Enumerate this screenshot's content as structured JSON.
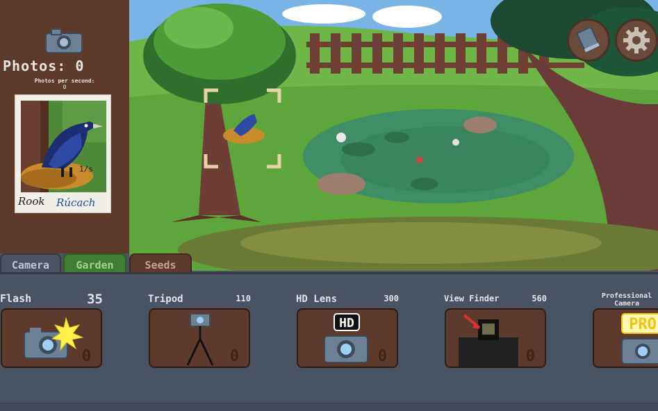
{
  "stats": {
    "photos_label": "Photos: 0",
    "pps_label": "Photos per second:",
    "pps_value": "0"
  },
  "polaroid": {
    "caption_left": "Rook",
    "caption_right": "Rúcach",
    "scrawl": "1/s"
  },
  "tabs": [
    {
      "label": "Camera",
      "active": true
    },
    {
      "label": "Garden",
      "active": false
    },
    {
      "label": "Seeds",
      "active": false
    }
  ],
  "shop": {
    "items": [
      {
        "name": "Flash",
        "price": "35",
        "owned": "0",
        "icon": "flash-camera-icon"
      },
      {
        "name": "Tripod",
        "price": "110",
        "owned": "0",
        "icon": "tripod-camera-icon"
      },
      {
        "name": "HD Lens",
        "price": "300",
        "owned": "0",
        "icon": "hd-camera-icon",
        "badge": "HD"
      },
      {
        "name": "View Finder",
        "price": "560",
        "owned": "0",
        "icon": "viewfinder-camera-icon"
      },
      {
        "name": "Professional Camera",
        "price": "",
        "owned": "",
        "icon": "pro-camera-icon",
        "badge": "PRO"
      }
    ]
  },
  "colors": {
    "panel": "#4a5361",
    "sidebar": "#5e3a2a",
    "item_box": "#5d3a2b",
    "garden_tab": "#3f7d33",
    "pro_badge": "#f7d43b"
  },
  "icons": [
    "camera-icon",
    "journal-book-icon",
    "settings-gear-icon",
    "viewfinder-reticle-icon"
  ]
}
